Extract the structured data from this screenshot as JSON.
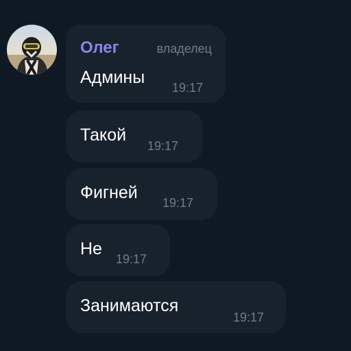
{
  "sender": {
    "name": "Олег",
    "role": "владелец"
  },
  "messages": [
    {
      "text": "Админы",
      "time": "19:17"
    },
    {
      "text": "Такой",
      "time": "19:17"
    },
    {
      "text": "Фигней",
      "time": "19:17"
    },
    {
      "text": "Не",
      "time": "19:17"
    },
    {
      "text": "Занимаются",
      "time": "19:17"
    }
  ],
  "colors": {
    "background": "#0f1923",
    "bubble": "#18222d",
    "sender_name": "#8f82e6",
    "timestamp": "#6f7c8a",
    "message_text": "#ffffff"
  }
}
